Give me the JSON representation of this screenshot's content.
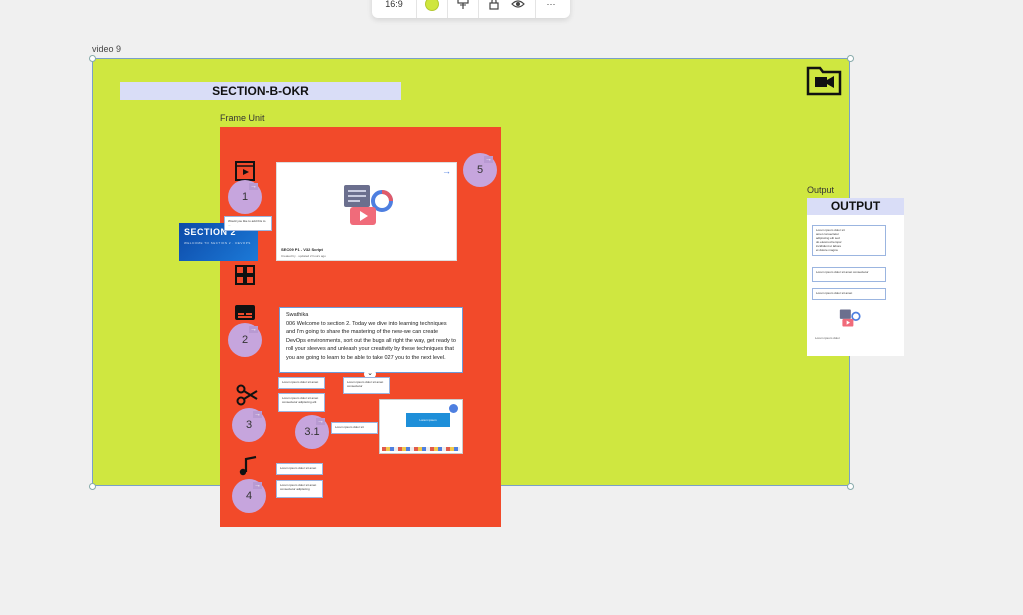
{
  "toolbar": {
    "aspect_ratio": "16:9",
    "board_color": "#cfe63d",
    "icons": [
      "paint-roller-icon",
      "lock-icon",
      "eye-icon",
      "more-icon"
    ],
    "more_label": "···"
  },
  "board": {
    "label": "video 9",
    "background": "#cfe740",
    "section_title": "SECTION-B-OKR"
  },
  "frame": {
    "label": "Frame Unit",
    "background": "#f24a2a"
  },
  "steps": [
    {
      "number": "1",
      "icon": "film-icon"
    },
    {
      "number": "2",
      "icon": "subtitles-icon"
    },
    {
      "number": "3",
      "icon": "scissors-icon"
    },
    {
      "number": "3.1",
      "icon": ""
    },
    {
      "number": "4",
      "icon": "music-note-icon"
    },
    {
      "number": "5",
      "icon": ""
    }
  ],
  "section_thumb": {
    "title": "SECTION 2",
    "subtitle": "WELCOME TO SECTION 2 · DEVOPS"
  },
  "note_small": "Would you like to add this to ...",
  "video_card": {
    "title": "SEC09 P1 - V32 Script",
    "meta": "Created by · updated 2 hours ago"
  },
  "transcript": {
    "speaker": "Swathika",
    "text": "006 Welcome to section 2. Today we dive into learning techniques and I'm going to share the mastering of the new-we can create DevOps environments, sort out the bugs all right the way, get ready to roll your sleeves and unleash your creativity by these techniques that you are going to learn to be able to take 027 you to the next level."
  },
  "mini_notes": [
    "Lorem ipsum dolor sit amet",
    "Lorem ipsum dolor sit amet consectetur",
    "Lorem ipsum dolor sit amet consectetur adipiscing elit",
    "Lorem ipsum dolor sit",
    "Lorem ipsum dolor sit amet",
    "Lorem ipsum dolor sit amet consectetur adipiscing"
  ],
  "output": {
    "label": "Output",
    "title": "OUTPUT",
    "lines": [
      "Lorem ipsum dolor sit",
      "amet consectetur",
      "adipiscing elit sed",
      "do eiusmod tempor",
      "incididunt ut labore",
      "et dolore magna"
    ],
    "box2": "Lorem ipsum dolor sit amet consectetur",
    "box3": "Lorem ipsum dolor sit amet",
    "footer": "Lorem ipsum dolor"
  },
  "screenshot_card": {
    "button": "Lorem ipsum"
  },
  "folder_icon": "folder-video-icon"
}
